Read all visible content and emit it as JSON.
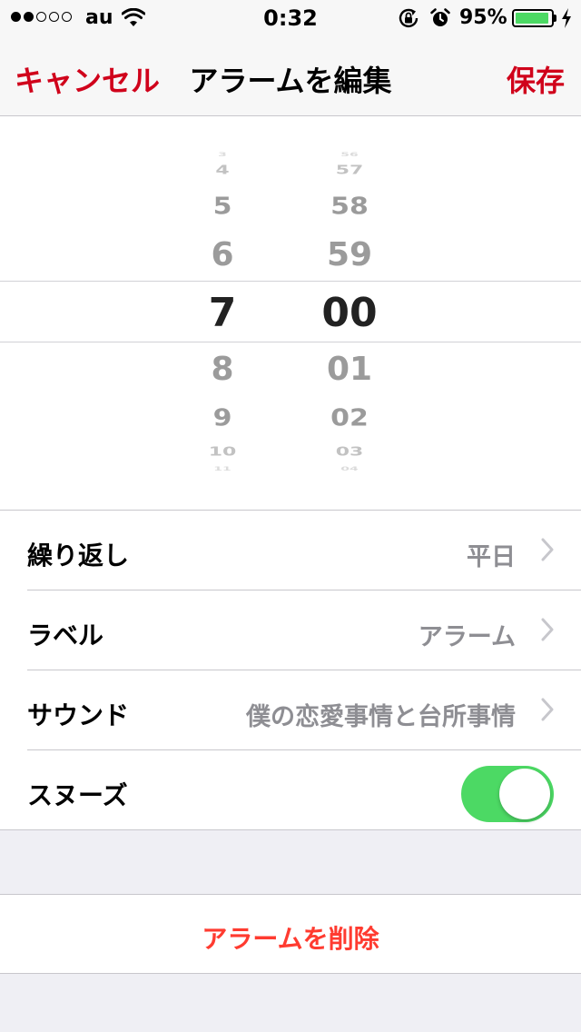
{
  "status_bar": {
    "carrier": "au",
    "time": "0:32",
    "battery_percent": "95%",
    "battery_level": 0.95,
    "signal_bars_filled": 2,
    "signal_bars_total": 5
  },
  "nav": {
    "cancel_label": "キャンセル",
    "title": "アラームを編集",
    "save_label": "保存"
  },
  "picker": {
    "hours": [
      "3",
      "4",
      "5",
      "6",
      "7",
      "8",
      "9",
      "10",
      "11"
    ],
    "minutes": [
      "56",
      "57",
      "58",
      "59",
      "00",
      "01",
      "02",
      "03",
      "04"
    ],
    "selected_hour": "7",
    "selected_minute": "00"
  },
  "settings": {
    "repeat": {
      "label": "繰り返し",
      "value": "平日"
    },
    "label": {
      "label": "ラベル",
      "value": "アラーム"
    },
    "sound": {
      "label": "サウンド",
      "value": "僕の恋愛事情と台所事情"
    },
    "snooze": {
      "label": "スヌーズ",
      "enabled": true
    }
  },
  "delete": {
    "label": "アラームを削除"
  },
  "colors": {
    "accent": "#d0021b",
    "destructive": "#ff3b30",
    "toggle_on": "#4cd964",
    "secondary_text": "#8e8e93",
    "background": "#efeff4"
  },
  "icons": [
    "wifi-icon",
    "rotation-lock-icon",
    "alarm-clock-icon",
    "battery-icon",
    "charging-bolt-icon",
    "chevron-right-icon"
  ]
}
